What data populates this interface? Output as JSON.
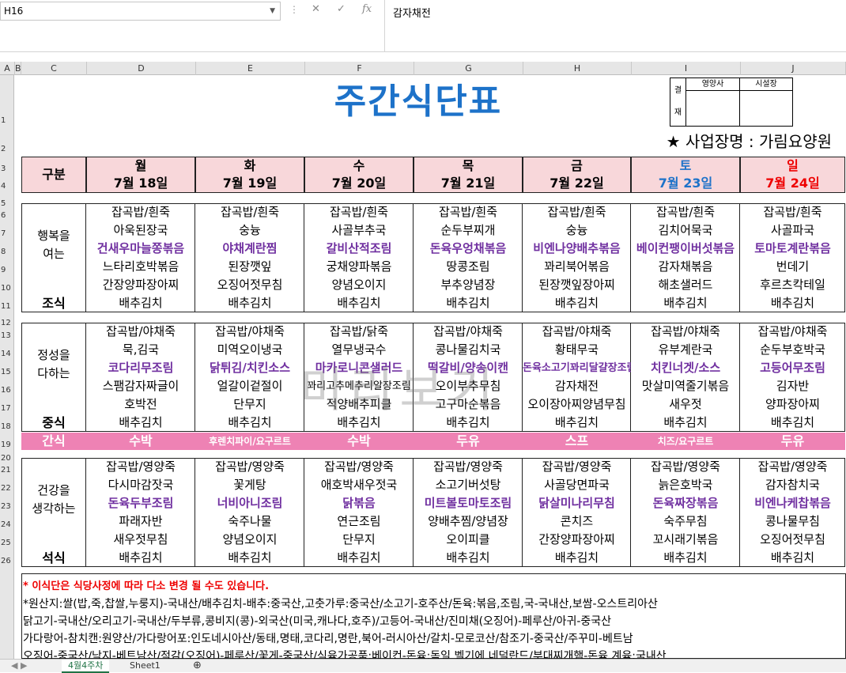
{
  "formula_bar": {
    "name_box": "H16",
    "formula": "감자채전"
  },
  "columns": [
    "A",
    "B",
    "C",
    "D",
    "E",
    "F",
    "G",
    "H",
    "I",
    "J"
  ],
  "rows": [
    "1",
    "2",
    "3",
    "4",
    "5",
    "6",
    "7",
    "8",
    "9",
    "10",
    "11",
    "12",
    "13",
    "14",
    "15",
    "16",
    "17",
    "18",
    "19",
    "20",
    "21",
    "22",
    "23",
    "24",
    "25",
    "26"
  ],
  "title": "주간식단표",
  "approval": {
    "k1": "결",
    "k2": "재",
    "c1": "영양사",
    "c2": "시설장"
  },
  "business": "★ 사업장명 : 가림요양원",
  "header": {
    "label": "구분",
    "days": [
      {
        "day": "월",
        "date": "7월 18일"
      },
      {
        "day": "화",
        "date": "7월 19일"
      },
      {
        "day": "수",
        "date": "7월 20일"
      },
      {
        "day": "목",
        "date": "7월 21일"
      },
      {
        "day": "금",
        "date": "7월 22일"
      },
      {
        "day": "토",
        "date": "7월 23일"
      },
      {
        "day": "일",
        "date": "7월 24일"
      }
    ]
  },
  "breakfast": {
    "label1": "행복을",
    "label2": "여는",
    "meal": "조식",
    "menu": [
      [
        "잡곡밥/흰죽",
        "아욱된장국",
        "건새우마늘쫑볶음",
        "느타리호박볶음",
        "간장양파장아찌",
        "배추김치"
      ],
      [
        "잡곡밥/흰죽",
        "숭늉",
        "야채계란찜",
        "된장깻잎",
        "오징어젓무침",
        "배추김치"
      ],
      [
        "잡곡밥/흰죽",
        "사골부추국",
        "갈비산적조림",
        "궁채양파볶음",
        "양념오이지",
        "배추김치"
      ],
      [
        "잡곡밥/흰죽",
        "순두부찌개",
        "돈육우엉채볶음",
        "땅콩조림",
        "부추양념장",
        "배추김치"
      ],
      [
        "잡곡밥/흰죽",
        "숭늉",
        "비엔나양배추볶음",
        "꽈리북어볶음",
        "된장깻잎장아찌",
        "배추김치"
      ],
      [
        "잡곡밥/흰죽",
        "김치어묵국",
        "베이컨팽이버섯볶음",
        "감자채볶음",
        "해초샐러드",
        "배추김치"
      ],
      [
        "잡곡밥/흰죽",
        "사골파국",
        "토마토계란볶음",
        "번데기",
        "후르츠칵테일",
        "배추김치"
      ]
    ]
  },
  "lunch": {
    "label1": "정성을",
    "label2": "다하는",
    "meal": "중식",
    "menu": [
      [
        "잡곡밥/야채죽",
        "묵,김국",
        "코다리무조림",
        "스팸감자짜글이",
        "호박전",
        "배추김치"
      ],
      [
        "잡곡밥/야채죽",
        "미역오이냉국",
        "닭튀김/치킨소스",
        "얼갈이겉절이",
        "단무지",
        "배추김치"
      ],
      [
        "잡곡밥/닭죽",
        "열무냉국수",
        "마카로니콘샐러드",
        "꽈리고추메추리알장조림",
        "적양배추피클",
        "배추김치"
      ],
      [
        "잡곡밥/야채죽",
        "콩나물김치국",
        "떡갈비/양송이캔",
        "오이부추무침",
        "고구마순볶음",
        "배추김치"
      ],
      [
        "잡곡밥/야채죽",
        "황태무국",
        "돈육소고기꽈리달걀장조림",
        "감자채전",
        "오이장아찌양념무침",
        "배추김치"
      ],
      [
        "잡곡밥/야채죽",
        "유부계란국",
        "치킨너겟/소스",
        "맛살미역줄기볶음",
        "새우젓",
        "배추김치"
      ],
      [
        "잡곡밥/야채죽",
        "순두부호박국",
        "고등어무조림",
        "김자반",
        "양파장아찌",
        "배추김치"
      ]
    ]
  },
  "snack": {
    "label": "간식",
    "items": [
      "수박",
      "후렌치파이/요구르트",
      "수박",
      "두유",
      "스프",
      "치즈/요구르트",
      "두유"
    ]
  },
  "dinner": {
    "label1": "건강을",
    "label2": "생각하는",
    "meal": "석식",
    "menu": [
      [
        "잡곡밥/영양죽",
        "다시마감잣국",
        "돈육두부조림",
        "파래자반",
        "새우젓무침",
        "배추김치"
      ],
      [
        "잡곡밥/영양죽",
        "꽃게탕",
        "너비아니조림",
        "숙주나물",
        "양념오이지",
        "배추김치"
      ],
      [
        "잡곡밥/영양죽",
        "애호박새우젓국",
        "닭볶음",
        "연근조림",
        "단무지",
        "배추김치"
      ],
      [
        "잡곡밥/영양죽",
        "소고기버섯탕",
        "미트볼토마토조림",
        "양배추찜/양념장",
        "오이피클",
        "배추김치"
      ],
      [
        "잡곡밥/영양죽",
        "사골당면파국",
        "닭살미나리무침",
        "콘치즈",
        "간장양파장아찌",
        "배추김치"
      ],
      [
        "잡곡밥/영양죽",
        "늙은호박국",
        "돈육짜장볶음",
        "숙주무침",
        "꼬시래기볶음",
        "배추김치"
      ],
      [
        "잡곡밥/영양죽",
        "감자참치국",
        "비엔나케찹볶음",
        "콩나물무침",
        "오징어젓무침",
        "배추김치"
      ]
    ]
  },
  "notes": [
    "* 이식단은  식당사정에 따라 다소 변경 될 수도 있습니다.",
    "*원산지:쌀(밥,죽,찹쌀,누룽지)-국내산/배추김치-배추:중국산,고춧가루:중국산/소고기-호주산/돈육:볶음,조림,국-국내산,보쌈-오스트리아산",
    "닭고기-국내산/오리고기-국내산/두부류,콩비지(콩)-외국산(미국,캐나다,호주)/고등어-국내산/진미채(오징어)-페루산/아귀-중국산",
    "가다랑어-참치캔:원양산/가다랑어포:인도네시아산/동태,명태,코다리,명란,북어-러시아산/갈치-모로코산/참조기-중국산/주꾸미-베트남",
    "오징어-중국산/낙지-베트남산/적감(오징어)-페루산/꽃게-중국산/식육가공품:베이컨-돈육:독일 벨기에 네덜란드/부대찌개햄-돈육 계육:국내산"
  ],
  "watermark": "미리보기",
  "tabs": [
    "4월4주차",
    "Sheet1"
  ]
}
